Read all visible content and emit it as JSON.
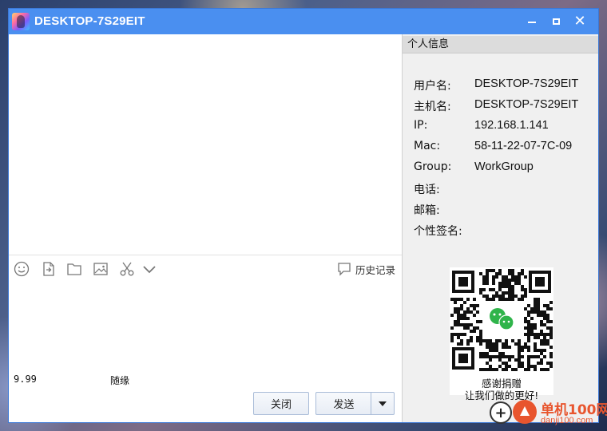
{
  "window": {
    "title": "DESKTOP-7S29EIT",
    "controls": {
      "minimize": "minimize-icon",
      "maximize": "maximize-icon",
      "close": "close-icon"
    },
    "accent_color": "#4a8ff0"
  },
  "toolbar": {
    "icons": [
      "smiley-icon",
      "send-file-icon",
      "folder-icon",
      "image-icon",
      "scissors-icon",
      "chevron-down-icon"
    ],
    "history_label": "历史记录"
  },
  "buttons": {
    "close_label": "关闭",
    "send_label": "发送"
  },
  "profile": {
    "header": "个人信息",
    "rows": [
      {
        "label": "用户名:",
        "value": "DESKTOP-7S29EIT"
      },
      {
        "label": "主机名:",
        "value": "DESKTOP-7S29EIT"
      },
      {
        "label": "IP:",
        "value": "192.168.1.141"
      },
      {
        "label": "Mac:",
        "value": "58-11-22-07-7C-09"
      },
      {
        "label": "Group:",
        "value": "WorkGroup"
      },
      {
        "label": "电话:",
        "value": ""
      },
      {
        "label": "邮箱:",
        "value": ""
      },
      {
        "label": "个性签名:",
        "value": ""
      }
    ]
  },
  "donation": {
    "caption1": "感谢捐赠",
    "caption2": "让我们做的更好!",
    "price": "9.99",
    "price_label": "随缘"
  },
  "watermark": {
    "name": "单机100网",
    "url": "danji100.com"
  }
}
